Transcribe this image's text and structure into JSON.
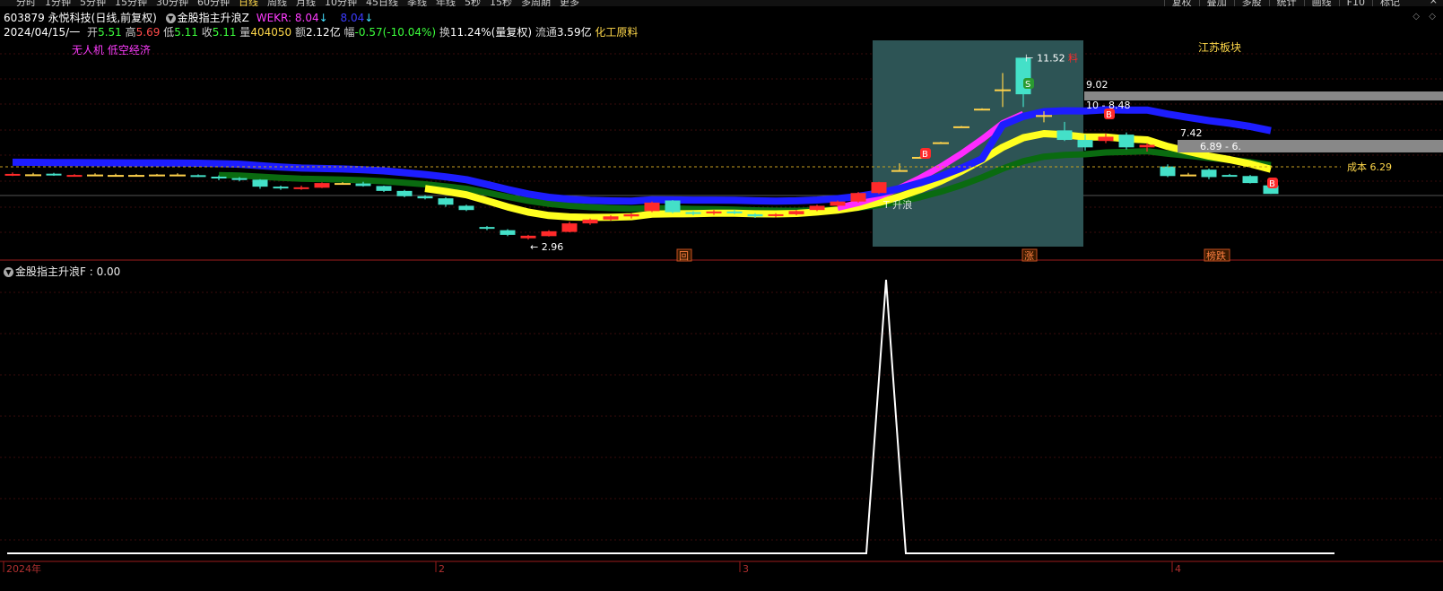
{
  "toolbar": {
    "tabs": [
      "分时",
      "1分钟",
      "5分钟",
      "15分钟",
      "30分钟",
      "60分钟",
      "日线",
      "周线",
      "月线",
      "10分钟",
      "45日线",
      "季线",
      "年线",
      "5秒",
      "15秒",
      "多周期",
      "更多"
    ],
    "active_tab": "日线",
    "right_tabs": [
      "复权",
      "叠加",
      "多股",
      "统计",
      "画线",
      "F10",
      "标记"
    ],
    "close": "×"
  },
  "stock": {
    "code": "603879",
    "name": "永悦科技",
    "mode": "(日线,前复权)",
    "indicator_name": "金股指主升浪Z",
    "wekr_label": "WEKR:",
    "wekr_value": "8.04",
    "wekr_value2": "8.04"
  },
  "quote": {
    "date": "2024/04/15/一",
    "open_label": "开",
    "open": "5.51",
    "high_label": "高",
    "high": "5.69",
    "low_label": "低",
    "low": "5.11",
    "close_label": "收",
    "close": "5.11",
    "vol_label": "量",
    "vol": "404050",
    "amount_label": "额",
    "amount": "2.12亿",
    "chg_label": "幅",
    "chg": "-0.57(-10.04%)",
    "turnover_label": "换",
    "turnover": "11.24%(量复权)",
    "float_label": "流通",
    "float": "3.59亿",
    "sector": "化工原料"
  },
  "tags": [
    "无人机",
    "低空经济"
  ],
  "annotations": {
    "low_price": "2.96",
    "high_price": "11.52",
    "high_suffix": "料",
    "level_902": "9.02",
    "level_848": "10 - 8.48",
    "level_742": "7.42",
    "level_689": "6.89 - 6.",
    "cost": "成本 6.29",
    "region": "江苏板块",
    "marker_hui": "回",
    "marker_zhang": "涨",
    "marker_bangdie": "榜跌",
    "marker_b": "B",
    "marker_s": "S",
    "tup_text": "T 升浪"
  },
  "indicator2": {
    "label": "金股指主升浪F",
    "value": ": 0.00"
  },
  "x_axis": {
    "labels": [
      "2024年",
      "2",
      "3",
      "4"
    ]
  },
  "colors": {
    "up": "#ff2a2a",
    "down": "#44e0c8",
    "doji": "#ffd24a",
    "ma_blue": "#1d1dff",
    "ma_magenta": "#ff2bff",
    "ma_yellow": "#ffff20",
    "ma_green": "#0a6b10",
    "highlight_box": "#2d5455",
    "grid": "#3a0c0c",
    "axis": "#9b1b1b"
  },
  "chart_data": [
    {
      "type": "candlestick",
      "title": "永悦科技 日线",
      "ylim": [
        2.5,
        12.0
      ],
      "note": "daily OHLC (approximate)",
      "candles": [
        {
          "o": 6.0,
          "h": 6.12,
          "l": 5.95,
          "c": 6.05
        },
        {
          "o": 6.03,
          "h": 6.1,
          "l": 5.98,
          "c": 6.02
        },
        {
          "o": 6.06,
          "h": 6.1,
          "l": 5.96,
          "c": 5.98
        },
        {
          "o": 5.97,
          "h": 6.04,
          "l": 5.92,
          "c": 6.0
        },
        {
          "o": 6.02,
          "h": 6.08,
          "l": 5.97,
          "c": 6.01
        },
        {
          "o": 6.0,
          "h": 6.06,
          "l": 5.95,
          "c": 5.98
        },
        {
          "o": 5.98,
          "h": 6.04,
          "l": 5.93,
          "c": 6.0
        },
        {
          "o": 6.0,
          "h": 6.05,
          "l": 5.95,
          "c": 6.02
        },
        {
          "o": 6.02,
          "h": 6.08,
          "l": 5.96,
          "c": 5.99
        },
        {
          "o": 5.99,
          "h": 6.03,
          "l": 5.9,
          "c": 5.92
        },
        {
          "o": 5.92,
          "h": 5.98,
          "l": 5.75,
          "c": 5.85
        },
        {
          "o": 5.85,
          "h": 5.9,
          "l": 5.7,
          "c": 5.78
        },
        {
          "o": 5.78,
          "h": 5.8,
          "l": 5.35,
          "c": 5.45
        },
        {
          "o": 5.45,
          "h": 5.5,
          "l": 5.3,
          "c": 5.4
        },
        {
          "o": 5.38,
          "h": 5.5,
          "l": 5.3,
          "c": 5.42
        },
        {
          "o": 5.4,
          "h": 5.65,
          "l": 5.38,
          "c": 5.62
        },
        {
          "o": 5.62,
          "h": 5.66,
          "l": 5.55,
          "c": 5.6
        },
        {
          "o": 5.6,
          "h": 5.68,
          "l": 5.45,
          "c": 5.48
        },
        {
          "o": 5.48,
          "h": 5.5,
          "l": 5.2,
          "c": 5.25
        },
        {
          "o": 5.25,
          "h": 5.3,
          "l": 4.95,
          "c": 5.0
        },
        {
          "o": 5.0,
          "h": 5.05,
          "l": 4.85,
          "c": 4.9
        },
        {
          "o": 4.9,
          "h": 4.95,
          "l": 4.5,
          "c": 4.6
        },
        {
          "o": 4.55,
          "h": 4.6,
          "l": 4.3,
          "c": 4.35
        },
        {
          "o": 3.55,
          "h": 3.6,
          "l": 3.4,
          "c": 3.5
        },
        {
          "o": 3.4,
          "h": 3.45,
          "l": 3.12,
          "c": 3.18
        },
        {
          "o": 3.02,
          "h": 3.18,
          "l": 2.96,
          "c": 3.14
        },
        {
          "o": 3.12,
          "h": 3.4,
          "l": 3.1,
          "c": 3.35
        },
        {
          "o": 3.32,
          "h": 3.8,
          "l": 3.3,
          "c": 3.72
        },
        {
          "o": 3.72,
          "h": 3.95,
          "l": 3.65,
          "c": 3.9
        },
        {
          "o": 3.9,
          "h": 4.1,
          "l": 3.85,
          "c": 4.05
        },
        {
          "o": 4.05,
          "h": 4.2,
          "l": 3.95,
          "c": 4.15
        },
        {
          "o": 4.3,
          "h": 4.75,
          "l": 4.25,
          "c": 4.7
        },
        {
          "o": 4.8,
          "h": 4.82,
          "l": 4.2,
          "c": 4.25
        },
        {
          "o": 4.25,
          "h": 4.3,
          "l": 4.1,
          "c": 4.2
        },
        {
          "o": 4.2,
          "h": 4.35,
          "l": 4.12,
          "c": 4.28
        },
        {
          "o": 4.28,
          "h": 4.35,
          "l": 4.15,
          "c": 4.2
        },
        {
          "o": 4.15,
          "h": 4.2,
          "l": 3.98,
          "c": 4.05
        },
        {
          "o": 4.08,
          "h": 4.2,
          "l": 4.0,
          "c": 4.15
        },
        {
          "o": 4.15,
          "h": 4.35,
          "l": 4.1,
          "c": 4.3
        },
        {
          "o": 4.35,
          "h": 4.6,
          "l": 4.3,
          "c": 4.55
        },
        {
          "o": 4.55,
          "h": 4.8,
          "l": 4.5,
          "c": 4.75
        },
        {
          "o": 4.75,
          "h": 5.2,
          "l": 4.7,
          "c": 5.15
        },
        {
          "o": 5.15,
          "h": 5.68,
          "l": 5.1,
          "c": 5.66
        },
        {
          "o": 6.23,
          "h": 6.55,
          "l": 6.2,
          "c": 6.23
        },
        {
          "o": 6.85,
          "h": 6.87,
          "l": 6.83,
          "c": 6.85
        },
        {
          "o": 7.54,
          "h": 7.56,
          "l": 7.52,
          "c": 7.54
        },
        {
          "o": 8.29,
          "h": 8.31,
          "l": 8.27,
          "c": 8.29
        },
        {
          "o": 9.12,
          "h": 9.14,
          "l": 9.1,
          "c": 9.12
        },
        {
          "o": 10.03,
          "h": 10.8,
          "l": 9.2,
          "c": 10.03
        },
        {
          "o": 11.52,
          "h": 11.52,
          "l": 9.2,
          "c": 9.8
        },
        {
          "o": 8.8,
          "h": 9.0,
          "l": 8.48,
          "c": 8.82
        },
        {
          "o": 8.1,
          "h": 8.5,
          "l": 7.6,
          "c": 7.65
        },
        {
          "o": 7.65,
          "h": 7.9,
          "l": 7.15,
          "c": 7.3
        },
        {
          "o": 7.6,
          "h": 7.95,
          "l": 7.5,
          "c": 7.8
        },
        {
          "o": 7.9,
          "h": 8.0,
          "l": 7.2,
          "c": 7.3
        },
        {
          "o": 7.3,
          "h": 7.5,
          "l": 7.1,
          "c": 7.42
        },
        {
          "o": 6.4,
          "h": 6.5,
          "l": 5.9,
          "c": 5.95
        },
        {
          "o": 6.0,
          "h": 6.1,
          "l": 5.98,
          "c": 6.02
        },
        {
          "o": 6.25,
          "h": 6.3,
          "l": 5.8,
          "c": 5.9
        },
        {
          "o": 6.0,
          "h": 6.05,
          "l": 5.95,
          "c": 5.97
        },
        {
          "o": 5.95,
          "h": 6.0,
          "l": 5.6,
          "c": 5.62
        },
        {
          "o": 5.51,
          "h": 5.69,
          "l": 5.11,
          "c": 5.11
        }
      ]
    },
    {
      "type": "line",
      "title": "金股指主升浪F",
      "ylim": [
        0,
        1
      ],
      "note": "pulse signal; 0 everywhere except a single spike around the 45th bar",
      "values_sparse": [
        {
          "bar": 0,
          "v": 0
        },
        {
          "bar": 42,
          "v": 0
        },
        {
          "bar": 44,
          "v": 1
        },
        {
          "bar": 46,
          "v": 0
        },
        {
          "bar": 61,
          "v": 0
        }
      ]
    }
  ]
}
